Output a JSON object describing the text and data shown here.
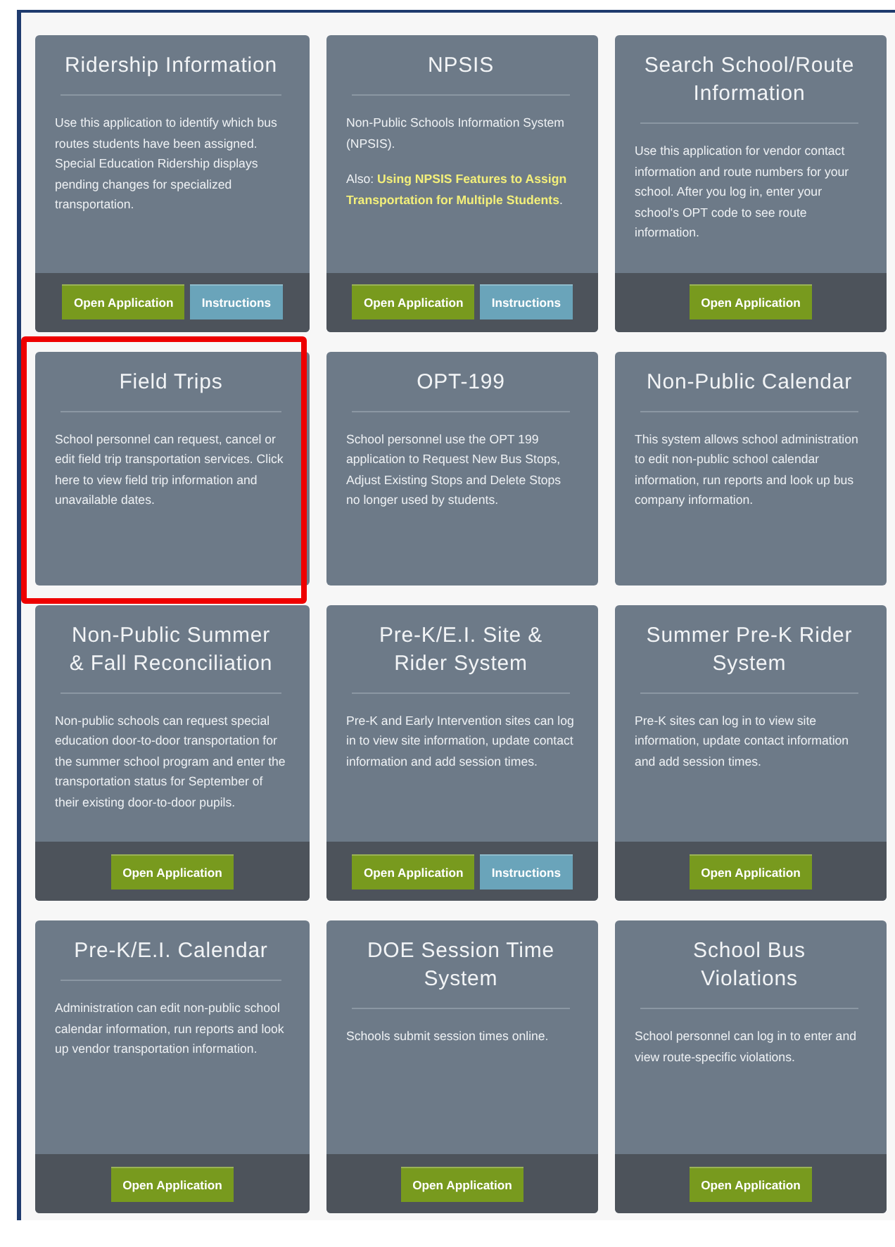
{
  "cards": [
    {
      "title": "Ridership Information",
      "highlighted": false,
      "paragraphs": [
        {
          "text": "Use this application to identify which bus routes students have been assigned. Special Education Ridership displays pending changes for specialized transportation."
        }
      ],
      "buttons": [
        {
          "label": "Open Application",
          "kind": "primary"
        },
        {
          "label": "Instructions",
          "kind": "secondary"
        }
      ]
    },
    {
      "title": "NPSIS",
      "highlighted": false,
      "paragraphs": [
        {
          "text": "Non-Public Schools Information System (NPSIS)."
        },
        {
          "text": "Also: **Using NPSIS Features to Assign Transportation for Multiple Students**."
        }
      ],
      "buttons": [
        {
          "label": "Open Application",
          "kind": "primary"
        },
        {
          "label": "Instructions",
          "kind": "secondary"
        }
      ]
    },
    {
      "title": "Search School/Route Information",
      "highlighted": false,
      "paragraphs": [
        {
          "text": "Use this application for vendor contact information and route numbers for your school. After you log in, enter your school's OPT code to see route information."
        }
      ],
      "buttons": [
        {
          "label": "Open Application",
          "kind": "primary"
        }
      ]
    },
    {
      "title": "Field Trips",
      "highlighted": true,
      "paragraphs": [
        {
          "text": "School personnel can request, cancel or edit field trip transportation services. Click here to view field trip information and unavailable dates."
        }
      ]
    },
    {
      "title": "OPT-199",
      "highlighted": false,
      "paragraphs": [
        {
          "text": "School personnel use the OPT 199 application to Request New Bus Stops, Adjust Existing Stops and Delete Stops no longer used by students."
        }
      ]
    },
    {
      "title": "Non-Public Calendar",
      "highlighted": false,
      "paragraphs": [
        {
          "text": "This system allows school administration to edit non-public school calendar information, run reports and look up bus company information."
        }
      ]
    },
    {
      "title": "Non-Public Summer & Fall Reconciliation",
      "highlighted": false,
      "paragraphs": [
        {
          "text": "Non-public schools can request special education door-to-door transportation for the summer school program and enter the transportation status for September of their existing door-to-door pupils."
        }
      ],
      "buttons": [
        {
          "label": "Open Application",
          "kind": "primary"
        }
      ]
    },
    {
      "title": "Pre-K/E.I. Site & Rider System",
      "highlighted": false,
      "paragraphs": [
        {
          "text": "Pre-K and Early Intervention sites can log in to view site information, update contact information and add session times."
        }
      ],
      "buttons": [
        {
          "label": "Open Application",
          "kind": "primary"
        },
        {
          "label": "Instructions",
          "kind": "secondary"
        }
      ]
    },
    {
      "title": "Summer Pre-K Rider System",
      "highlighted": false,
      "paragraphs": [
        {
          "text": "Pre-K sites can log in to view site information, update contact information and add session times."
        }
      ],
      "buttons": [
        {
          "label": "Open Application",
          "kind": "primary"
        }
      ]
    },
    {
      "title": "Pre-K/E.I. Calendar",
      "highlighted": false,
      "paragraphs": [
        {
          "text": "Administration can edit non-public school calendar information, run reports and look up vendor transportation information."
        }
      ],
      "buttons": [
        {
          "label": "Open Application",
          "kind": "primary"
        }
      ]
    },
    {
      "title": "DOE Session Time System",
      "highlighted": false,
      "paragraphs": [
        {
          "text": "Schools submit session times online."
        }
      ],
      "buttons": [
        {
          "label": "Open Application",
          "kind": "primary"
        }
      ]
    },
    {
      "title": "School Bus Violations",
      "highlighted": false,
      "paragraphs": [
        {
          "text": "School personnel can log in to enter and view route-specific violations."
        }
      ],
      "buttons": [
        {
          "label": "Open Application",
          "kind": "primary"
        }
      ]
    }
  ]
}
